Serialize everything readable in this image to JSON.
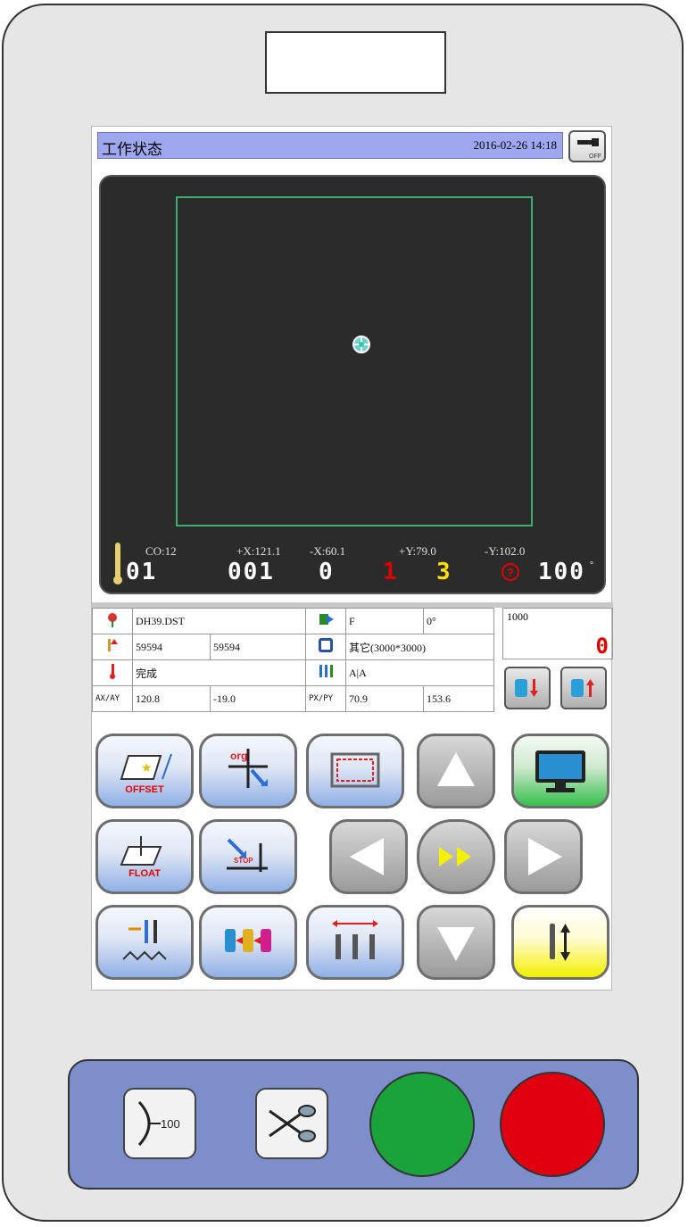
{
  "header": {
    "title": "工作状态",
    "datetime": "2016-02-26  14:18",
    "off_label": "OFF"
  },
  "canvas": {
    "co_label": "CO:12",
    "needle_value": "01",
    "xplus_label": "+X:121.1",
    "xplus_value": "001",
    "xminus_label": "-X:60.1",
    "xminus_value": "0",
    "yplus_label": "+Y:79.0",
    "red_value": "1",
    "yplus_value": "3",
    "yminus_label": "-Y:102.0",
    "speed_value": "100"
  },
  "info": {
    "file_name": "DH39.DST",
    "stitch_a": "59594",
    "stitch_b": "59594",
    "status": "完成",
    "axay_label": "AX/AY",
    "ax": "120.8",
    "ay": "-19.0",
    "mode": "F",
    "angle": "0°",
    "frame_type": "其它(3000*3000)",
    "head": "A|A",
    "pxpy_label": "PX/PY",
    "px": "70.9",
    "py": "153.6",
    "speed_setting": "1000",
    "counter": "0"
  },
  "buttons": {
    "offset_label": "OFFSET",
    "org_label": "org",
    "float_label": "FLOAT",
    "stop_label": "STOP"
  },
  "panel": {
    "trim_label": "100"
  }
}
